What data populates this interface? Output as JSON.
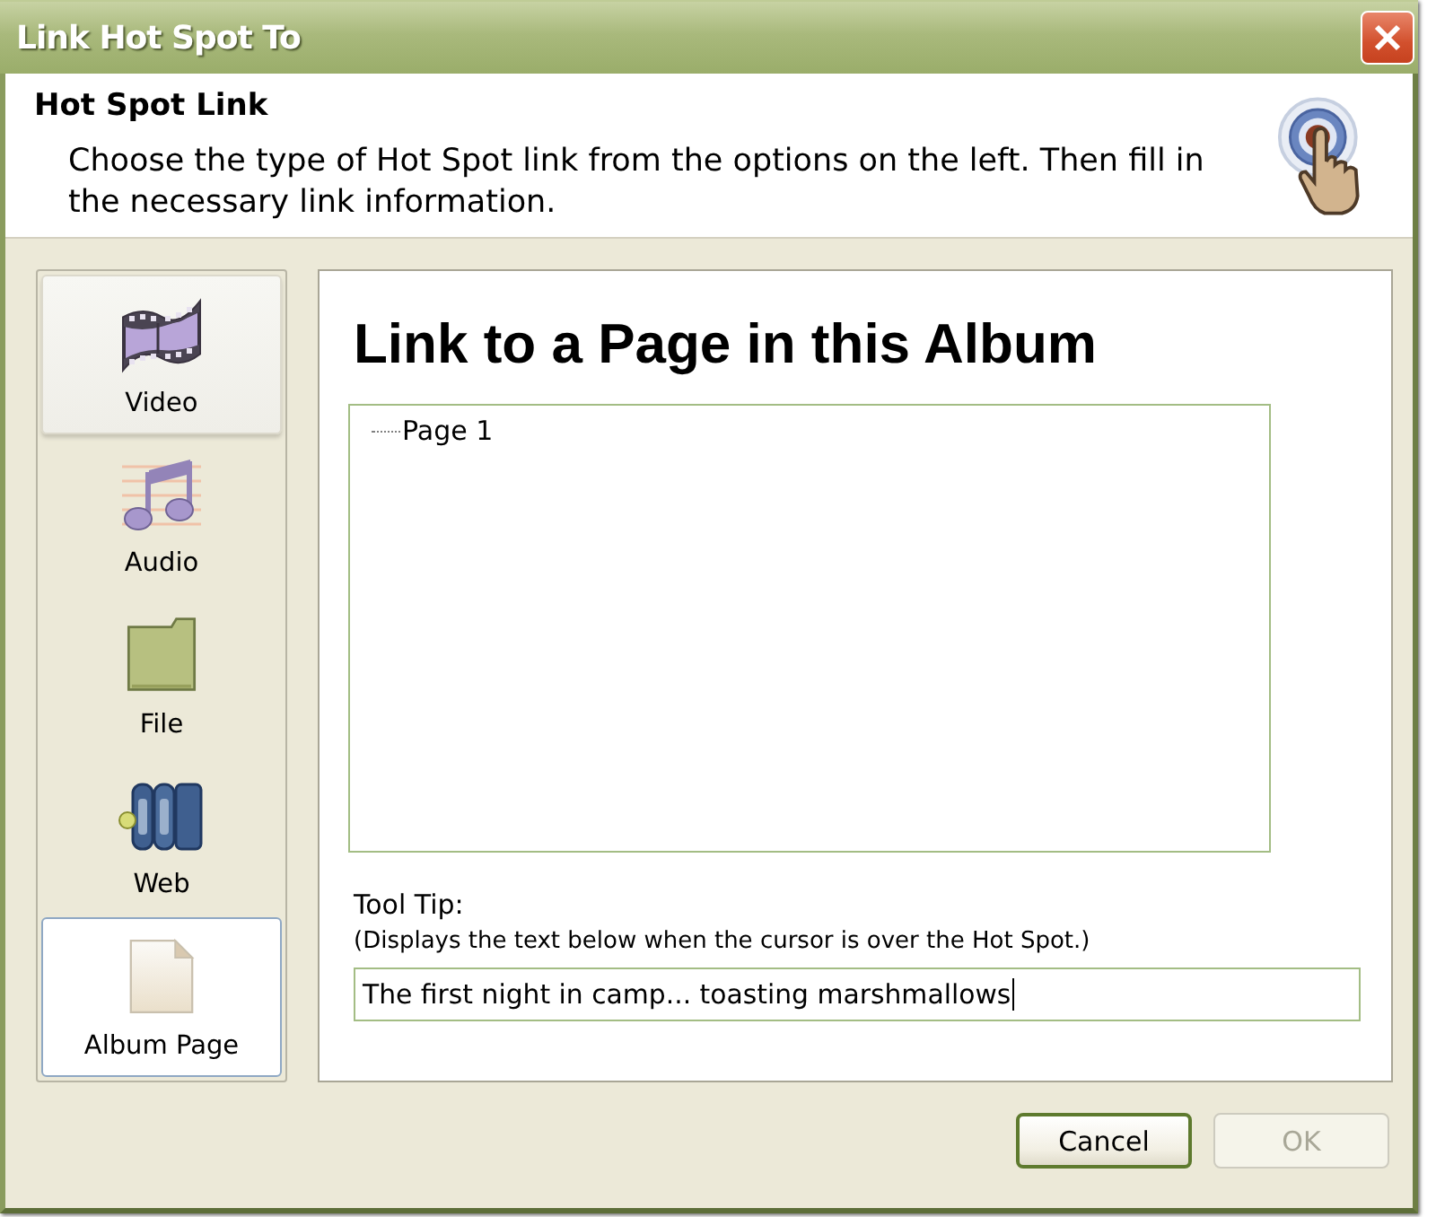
{
  "window": {
    "title": "Link Hot Spot To"
  },
  "header": {
    "title": "Hot Spot Link",
    "description": "Choose the type of Hot Spot link from the options on the left. Then fill in the necessary link information."
  },
  "link_types": [
    {
      "kind": "video",
      "label": "Video",
      "selected": false,
      "hovered": true
    },
    {
      "kind": "audio",
      "label": "Audio",
      "selected": false,
      "hovered": false
    },
    {
      "kind": "file",
      "label": "File",
      "selected": false,
      "hovered": false
    },
    {
      "kind": "web",
      "label": "Web",
      "selected": false,
      "hovered": false
    },
    {
      "kind": "page",
      "label": "Album Page",
      "selected": true,
      "hovered": false
    }
  ],
  "panel": {
    "title": "Link to a Page in this Album",
    "pages": [
      {
        "label": "Page 1"
      }
    ],
    "tooltip": {
      "label": "Tool Tip:",
      "hint": "(Displays the text below when the cursor is over the Hot Spot.)",
      "value": "The first night in camp... toasting marshmallows",
      "focused": true
    }
  },
  "buttons": [
    {
      "label": "Cancel",
      "default": true,
      "disabled": false
    },
    {
      "label": "OK",
      "default": false,
      "disabled": true
    }
  ]
}
